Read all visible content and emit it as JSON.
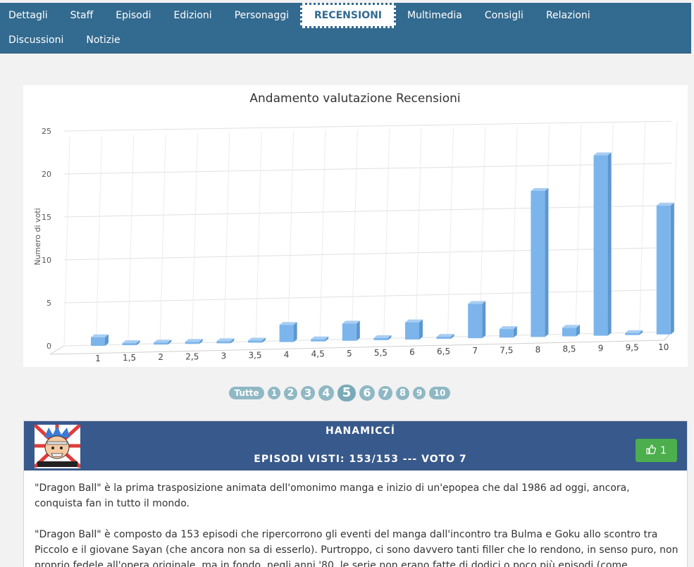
{
  "nav": {
    "row1": [
      "Dettagli",
      "Staff",
      "Episodi",
      "Edizioni",
      "Personaggi",
      "RECENSIONI",
      "Multimedia",
      "Consigli",
      "Relazioni"
    ],
    "row2": [
      "Discussioni",
      "Notizie"
    ],
    "active": "RECENSIONI"
  },
  "chart_data": {
    "type": "bar",
    "title": "Andamento valutazione Recensioni",
    "ylabel": "Numero di voti",
    "xlabel": "",
    "categories": [
      "1",
      "1,5",
      "2",
      "2,5",
      "3",
      "3,5",
      "4",
      "4,5",
      "5",
      "5,5",
      "6",
      "6,5",
      "7",
      "7,5",
      "8",
      "8,5",
      "9",
      "9,5",
      "10"
    ],
    "values": [
      1,
      0,
      0,
      0,
      0,
      0,
      2,
      0,
      2,
      0,
      2,
      0,
      4,
      1,
      17,
      1,
      21,
      0,
      15
    ],
    "ylim": [
      0,
      25
    ],
    "yticks": [
      0,
      5,
      10,
      15,
      20,
      25
    ],
    "grid": true,
    "color": "#7cb5ec"
  },
  "pager": {
    "pages": [
      "Tutte",
      "1",
      "2",
      "3",
      "4",
      "5",
      "6",
      "7",
      "8",
      "9",
      "10"
    ],
    "current": "5"
  },
  "review": {
    "author": "HANAMICCÍ",
    "episodes_line": "EPISODI VISTI: 153/153 --- VOTO 7",
    "likes": "1",
    "paragraphs": [
      "\"Dragon Ball\" è la prima trasposizione animata dell'omonimo manga e inizio di un'epopea che dal 1986 ad oggi, ancora, conquista fan in tutto il mondo.",
      "\"Dragon Ball\" è composto da 153 episodi che ripercorrono gli eventi del manga dall'incontro tra Bulma e Goku allo scontro tra Piccolo e il giovane Sayan (che ancora non sa di esserlo). Purtroppo, ci sono davvero tanti filler che lo rendono, in senso puro, non proprio fedele all'opera originale, ma in fondo, negli anni '80, le serie non erano fatte di dodici o poco più episodi (come"
    ]
  }
}
